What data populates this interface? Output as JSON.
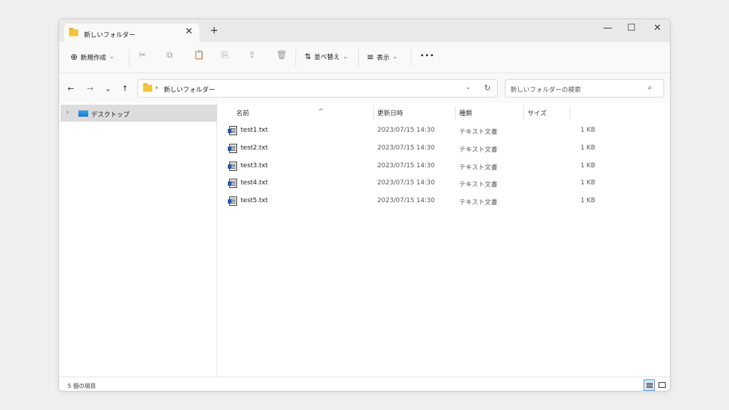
{
  "window": {
    "tab_title": "新しいフォルダー",
    "tab_close": "✕",
    "new_tab": "+",
    "controls": {
      "minimize": "—",
      "maximize": "☐",
      "close": "✕"
    }
  },
  "toolbar": {
    "new_label": "新規作成",
    "new_icon": "⊕",
    "dropdown": "⌄",
    "sort_label": "並べ替え",
    "sort_icon": "⇅",
    "view_label": "表示",
    "view_icon": "≡",
    "more": "•••",
    "icons": {
      "cut": "✂",
      "copy": "⧉",
      "paste": "📋",
      "rename": "⎘",
      "share": "⇪",
      "delete": "🗑"
    }
  },
  "nav": {
    "back": "←",
    "forward": "→",
    "recent": "⌄",
    "up": "↑",
    "path_chevron": "›",
    "path": "新しいフォルダー",
    "address_dropdown": "⌄",
    "refresh": "↻",
    "search_placeholder": "新しいフォルダーの検索",
    "search_icon": "⌕"
  },
  "sidebar": {
    "items": [
      {
        "label": "デスクトップ",
        "chevron": "›"
      }
    ]
  },
  "columns": {
    "name": "名前",
    "date": "更新日時",
    "type": "種類",
    "size": "サイズ",
    "sort_caret": "^"
  },
  "files": [
    {
      "name": "test1.txt",
      "date": "2023/07/15 14:30",
      "type": "テキスト文書",
      "size": "1 KB"
    },
    {
      "name": "test2.txt",
      "date": "2023/07/15 14:30",
      "type": "テキスト文書",
      "size": "1 KB"
    },
    {
      "name": "test3.txt",
      "date": "2023/07/15 14:30",
      "type": "テキスト文書",
      "size": "1 KB"
    },
    {
      "name": "test4.txt",
      "date": "2023/07/15 14:30",
      "type": "テキスト文書",
      "size": "1 KB"
    },
    {
      "name": "test5.txt",
      "date": "2023/07/15 14:30",
      "type": "テキスト文書",
      "size": "1 KB"
    }
  ],
  "status": {
    "count": "5 個の項目"
  },
  "colors": {
    "accent": "#5b9bd5",
    "folder": "#f4c542",
    "selected": "#dcdcdc"
  }
}
